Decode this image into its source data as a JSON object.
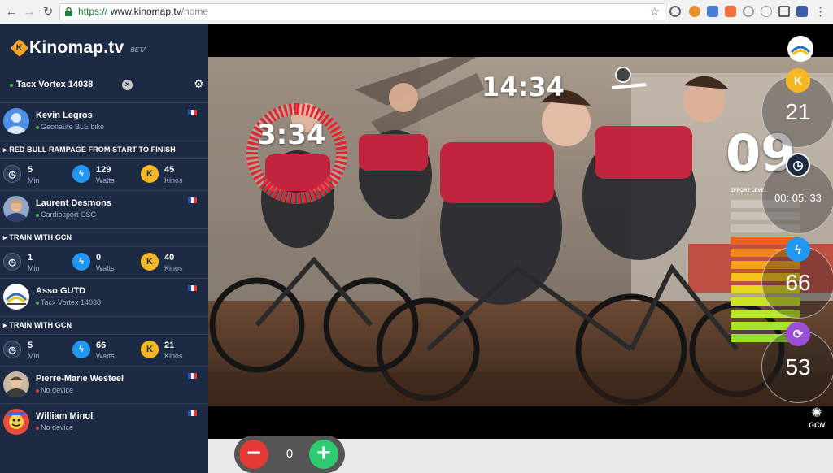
{
  "browser": {
    "url_scheme": "https://",
    "url_host": "www.kinomap.tv",
    "url_path": "/home"
  },
  "sidebar": {
    "logo_mark": "K",
    "brand": "Kinomap.tv",
    "beta": "BETA",
    "device_name": "Tacx Vortex 14038",
    "device_close": "×",
    "users": [
      {
        "name": "Kevin Legros",
        "device": "Geonaute BLE bike",
        "status_color": "#4caf50"
      },
      {
        "name": "Laurent Desmons",
        "device": "Cardiosport CSC",
        "status_color": "#4caf50"
      },
      {
        "name": "Asso GUTD",
        "device": "Tacx Vortex 14038",
        "status_color": "#4caf50"
      },
      {
        "name": "Pierre-Marie Westeel",
        "device": "No device",
        "status_color": "#e53935"
      },
      {
        "name": "William Minol",
        "device": "No device",
        "status_color": "#e53935"
      }
    ],
    "sessions": [
      {
        "title": "▸ RED BULL RAMPAGE FROM START TO FINISH",
        "minutes": "5",
        "minutes_unit": "Min",
        "watts": "129",
        "watts_unit": "Watts",
        "kinos": "45",
        "kinos_unit": "Kinos"
      },
      {
        "title": "▸ TRAIN WITH GCN",
        "minutes": "1",
        "minutes_unit": "Min",
        "watts": "0",
        "watts_unit": "Watts",
        "kinos": "40",
        "kinos_unit": "Kinos"
      },
      {
        "title": "▸ TRAIN WITH GCN",
        "minutes": "5",
        "minutes_unit": "Min",
        "watts": "66",
        "watts_unit": "Watts",
        "kinos": "21",
        "kinos_unit": "Kinos"
      }
    ]
  },
  "video": {
    "interval_timer": "3:34",
    "total_timer": "14:34",
    "effort_number": "09",
    "effort_label": "EFFORT LEVEL",
    "effort_level": 9,
    "effort_max": 12,
    "channel_logo": "GCN"
  },
  "hud": {
    "kinos_badge": "K",
    "kinos": "21",
    "elapsed": "00: 05: 33",
    "watts": "66",
    "cadence": "53"
  },
  "counter": {
    "minus": "−",
    "value": "0",
    "plus": "+"
  },
  "colors": {
    "sidebar_bg": "#1c2a44",
    "kinos": "#f5b823",
    "watts": "#2196f3",
    "cadence": "#9c4fd6",
    "minus": "#e53935",
    "plus": "#2ecc71"
  }
}
